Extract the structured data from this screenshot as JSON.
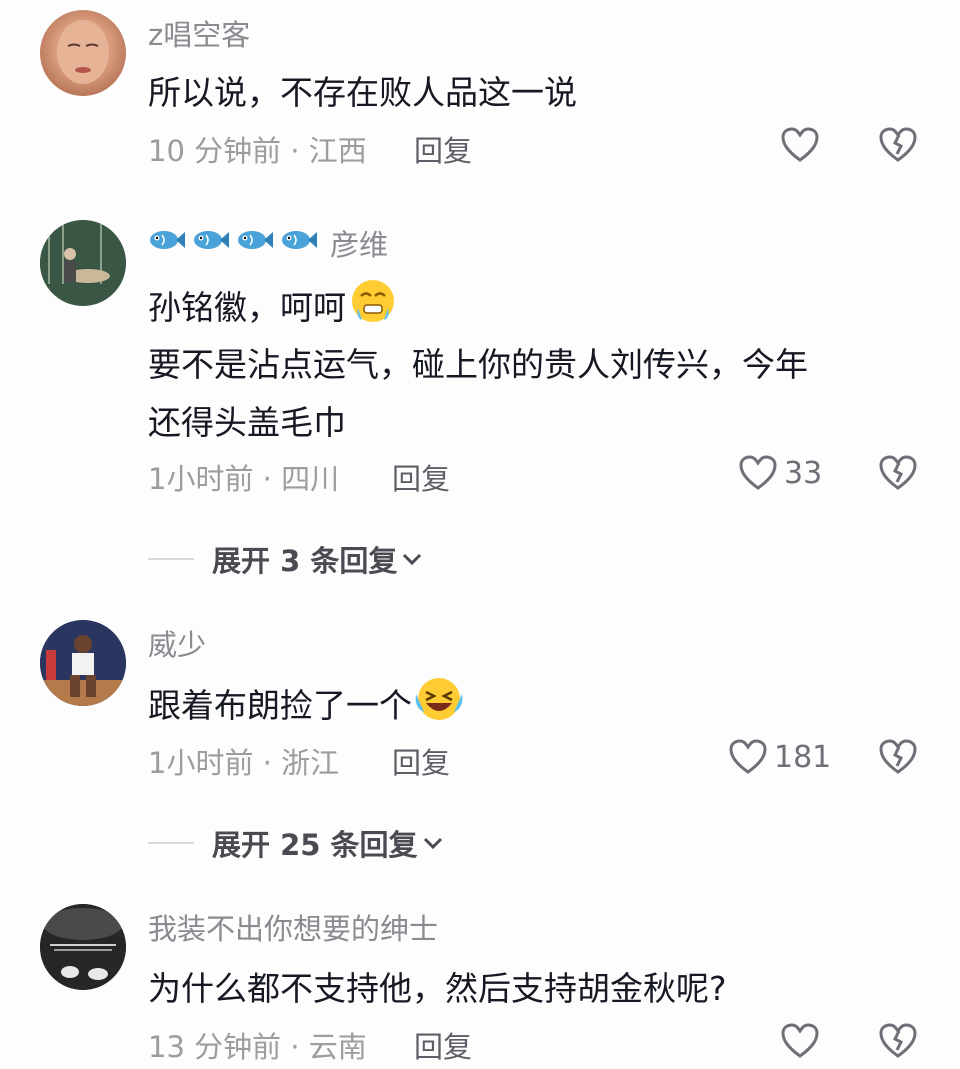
{
  "comments": [
    {
      "username": "z唱空客",
      "text": "所以说，不存在败人品这一说",
      "time": "10 分钟前 · 江西",
      "reply": "回复",
      "likes": ""
    },
    {
      "username": "彦维",
      "badges": [
        "fish-icon",
        "fish-icon",
        "fish-icon",
        "fish-icon"
      ],
      "text_line1": "孙铭徽，呵呵",
      "text_line2": "要不是沾点运气，碰上你的贵人刘传兴，今年",
      "text_line3": "还得头盖毛巾",
      "time": "1小时前 · 四川",
      "reply": "回复",
      "likes": "33",
      "expand": "展开 3 条回复"
    },
    {
      "username": "威少",
      "text": "跟着布朗捡了一个",
      "time": "1小时前 · 浙江",
      "reply": "回复",
      "likes": "181",
      "expand": "展开 25 条回复"
    },
    {
      "username": "我装不出你想要的绅士",
      "text": "为什么都不支持他，然后支持胡金秋呢?",
      "time": "13 分钟前 · 云南",
      "reply": "回复",
      "likes": ""
    }
  ],
  "colors": {
    "text": "#161823",
    "secondary": "#9c9ca1",
    "icon": "#6f7077"
  }
}
